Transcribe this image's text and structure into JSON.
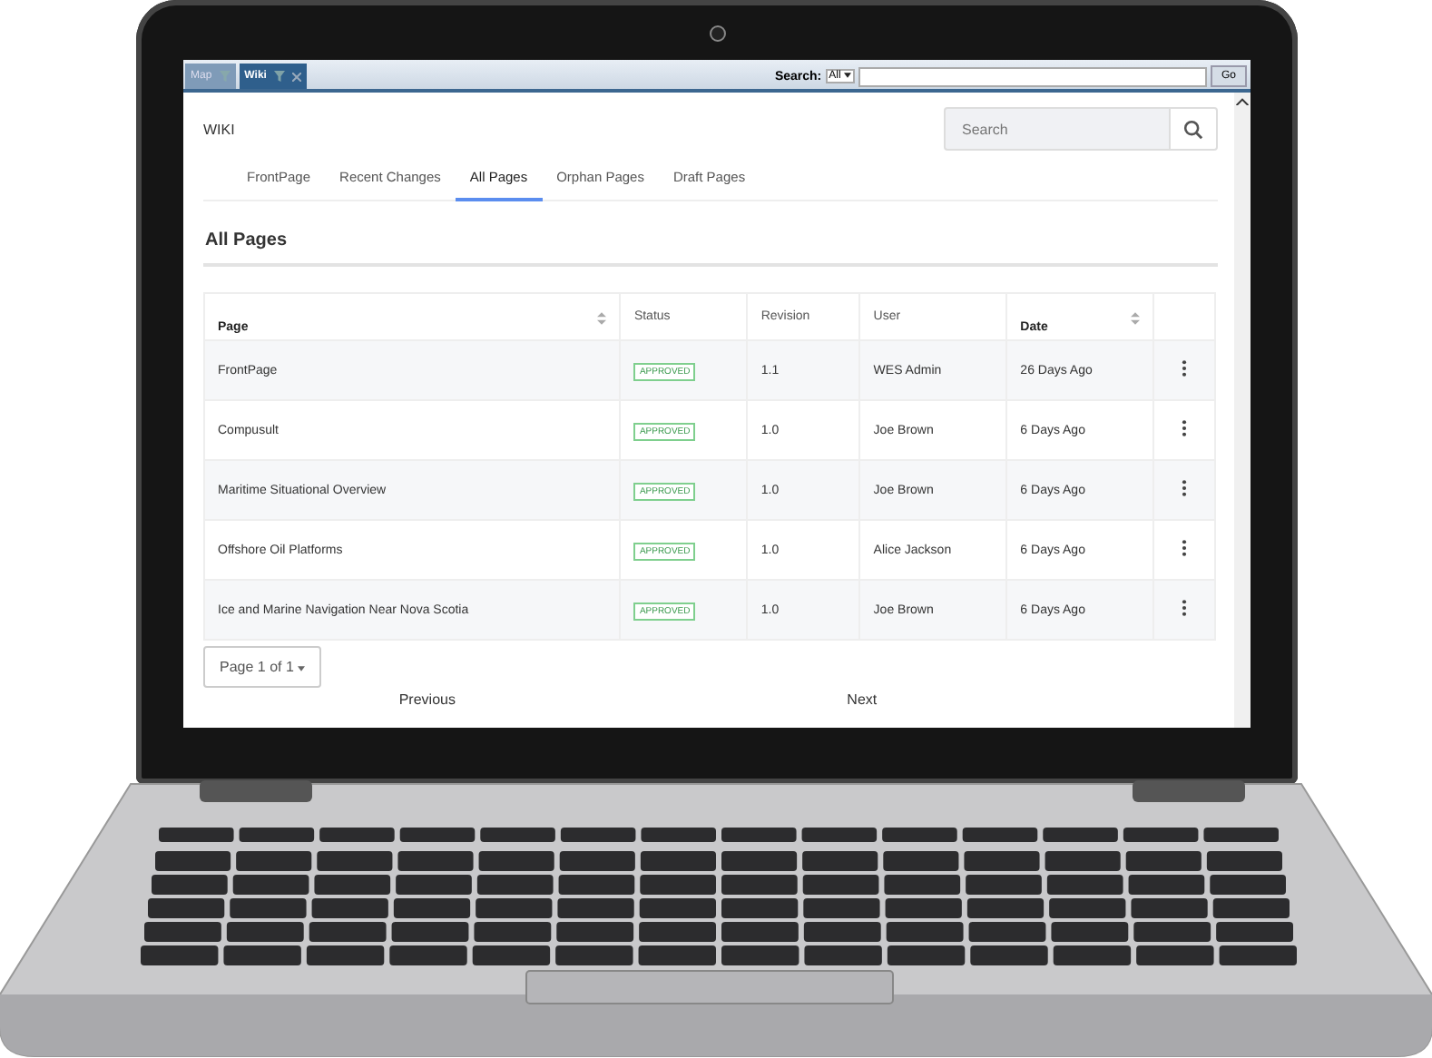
{
  "app_tabs": [
    {
      "label": "Map",
      "selected": false,
      "closable": false
    },
    {
      "label": "Wiki",
      "selected": true,
      "closable": true
    }
  ],
  "search_bar": {
    "label": "Search:",
    "scope": "All",
    "button": "Go"
  },
  "wiki": {
    "title": "WIKI",
    "search": {
      "placeholder": "Search"
    },
    "tabs": [
      {
        "label": "FrontPage",
        "selected": false
      },
      {
        "label": "Recent Changes",
        "selected": false
      },
      {
        "label": "All Pages",
        "selected": true
      },
      {
        "label": "Orphan Pages",
        "selected": false
      },
      {
        "label": "Draft Pages",
        "selected": false
      }
    ],
    "heading": "All Pages",
    "table": {
      "columns": [
        {
          "label": "Page",
          "sortable": true
        },
        {
          "label": "Status",
          "sortable": false
        },
        {
          "label": "Revision",
          "sortable": false
        },
        {
          "label": "User",
          "sortable": false
        },
        {
          "label": "Date",
          "sortable": true
        }
      ],
      "rows": [
        {
          "page": "FrontPage",
          "status": "APPROVED",
          "revision": "1.1",
          "user": "WES Admin",
          "date": "26 Days Ago"
        },
        {
          "page": "Compusult",
          "status": "APPROVED",
          "revision": "1.0",
          "user": "Joe Brown",
          "date": "6 Days Ago"
        },
        {
          "page": "Maritime Situational Overview",
          "status": "APPROVED",
          "revision": "1.0",
          "user": "Joe Brown",
          "date": "6 Days Ago"
        },
        {
          "page": "Offshore Oil Platforms",
          "status": "APPROVED",
          "revision": "1.0",
          "user": "Alice Jackson",
          "date": "6 Days Ago"
        },
        {
          "page": "Ice and Marine Navigation Near Nova Scotia",
          "status": "APPROVED",
          "revision": "1.0",
          "user": "Joe Brown",
          "date": "6 Days Ago"
        }
      ]
    },
    "pagination": {
      "label": "Page 1 of 1",
      "previous": "Previous",
      "next": "Next"
    }
  }
}
